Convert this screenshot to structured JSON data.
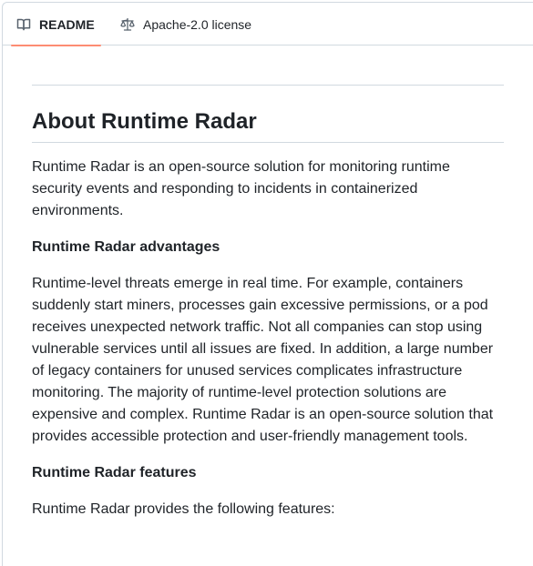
{
  "tabs": [
    {
      "label": "README",
      "icon": "book-icon",
      "active": true
    },
    {
      "label": "Apache-2.0 license",
      "icon": "law-scale-icon",
      "active": false
    }
  ],
  "colors": {
    "active_tab_underline": "#fd8c73",
    "border": "#d1d9e0",
    "text": "#1f2328"
  },
  "readme": {
    "title": "About Runtime Radar",
    "intro": "Runtime Radar is an open-source solution for monitoring runtime security events and responding to incidents in containerized environments.",
    "advantages_heading": "Runtime Radar advantages",
    "advantages_text": "Runtime-level threats emerge in real time. For example, containers suddenly start miners, processes gain excessive permissions, or a pod receives unexpected network traffic. Not all companies can stop using vulnerable services until all issues are fixed. In addition, a large number of legacy containers for unused services complicates infrastructure monitoring. The majority of runtime-level protection solutions are expensive and complex. Runtime Radar is an open-source solution that provides accessible protection and user-friendly management tools.",
    "features_heading": "Runtime Radar features",
    "features_intro": "Runtime Radar provides the following features:"
  }
}
